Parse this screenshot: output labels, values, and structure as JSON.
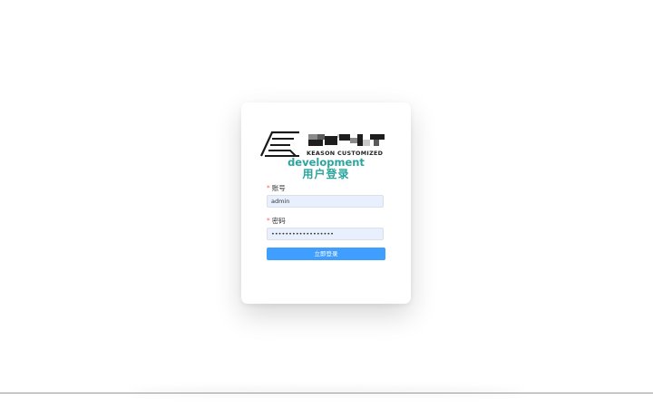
{
  "logo": {
    "caption": "KEASON CUSTOMIZED"
  },
  "login": {
    "subtitle": "development",
    "title": "用户登录",
    "account_label": "账号",
    "account_value": "admin",
    "password_label": "密码",
    "password_value": "••••••••••••••••••",
    "required_mark": "*",
    "submit_label": "立即登录"
  },
  "colors": {
    "accent": "#2aa59d",
    "button": "#409eff",
    "input_bg": "#e8f0fe",
    "required": "#f56c6c"
  }
}
